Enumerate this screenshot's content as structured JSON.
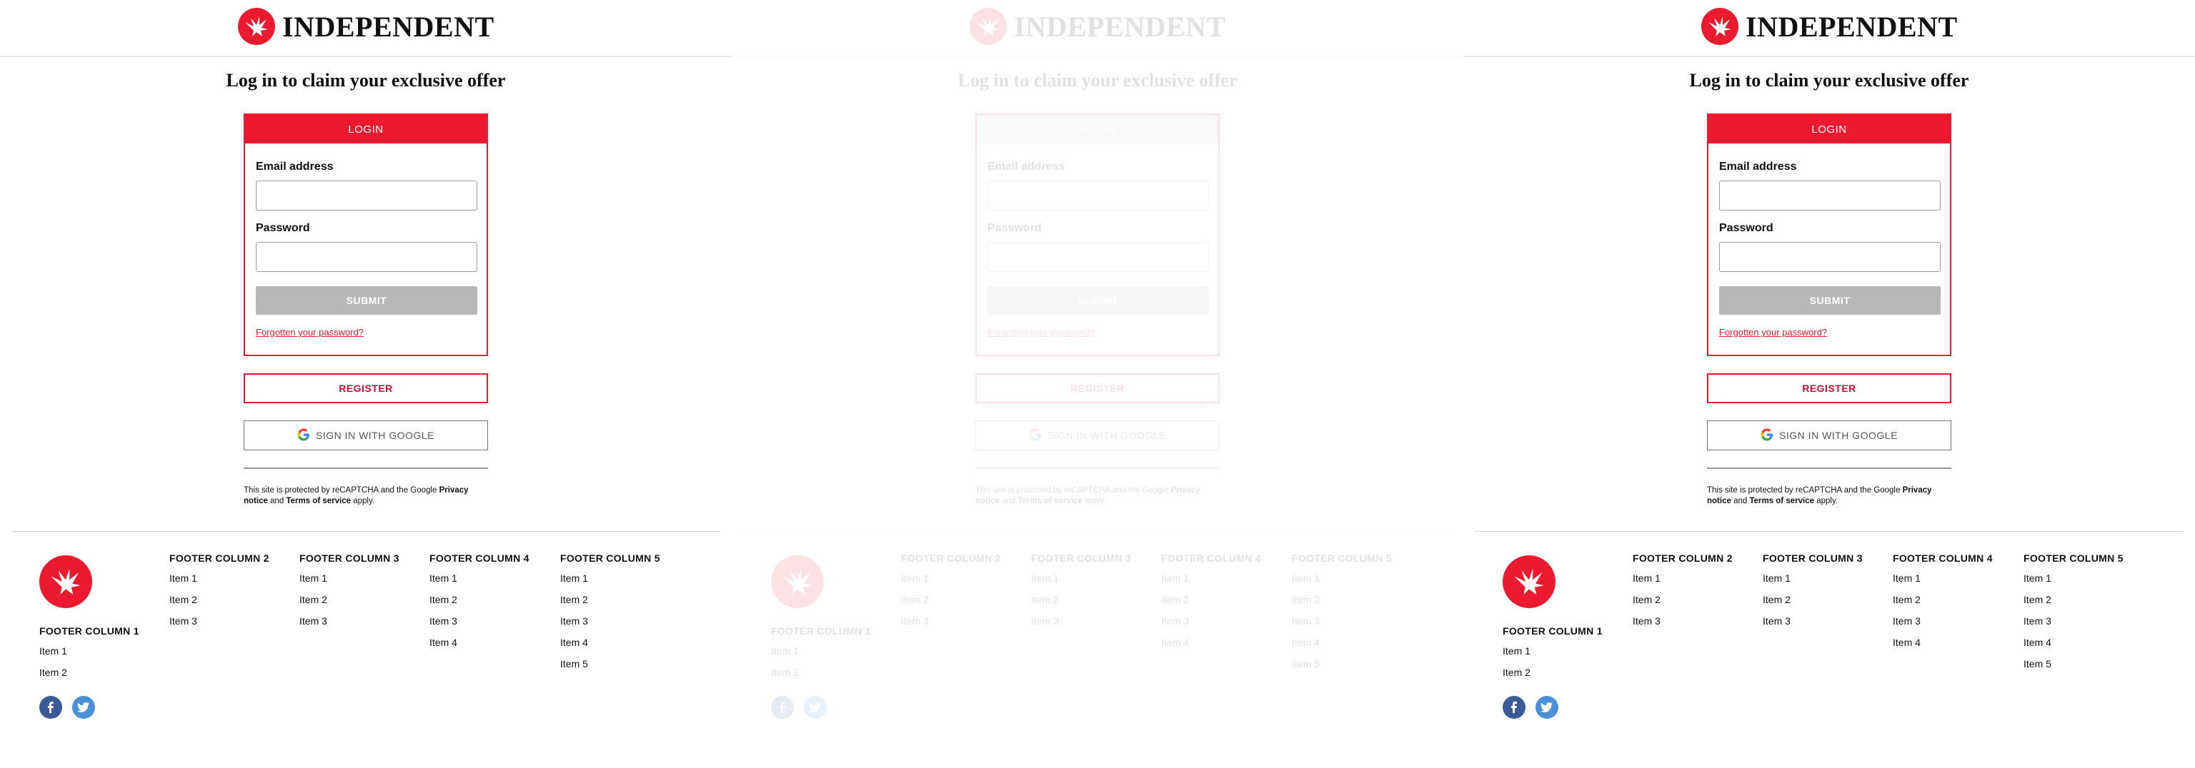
{
  "brand": {
    "name": "INDEPENDENT",
    "icon": "eagle-logo-icon",
    "accent": "#ec1a2e"
  },
  "page": {
    "title": "Log in to claim your exclusive offer"
  },
  "login": {
    "tab_label": "LOGIN",
    "email_label": "Email address",
    "email_value": "",
    "password_label": "Password",
    "password_value": "",
    "toggle_icon": "eye-off-icon",
    "submit_label": "SUBMIT",
    "forgot_label": "Forgotten your password?"
  },
  "register_label": "REGISTER",
  "google_label": "SIGN IN WITH GOOGLE",
  "recaptcha": {
    "prefix": "This site is protected by reCAPTCHA and the Google ",
    "privacy": "Privacy notice",
    "and": " and ",
    "terms": "Terms of service",
    "suffix": " apply."
  },
  "footer": {
    "columns": [
      {
        "title": "FOOTER COLUMN 1",
        "items": [
          "Item 1",
          "Item 2"
        ]
      },
      {
        "title": "FOOTER COLUMN 2",
        "items": [
          "Item 1",
          "Item 2",
          "Item 3"
        ]
      },
      {
        "title": "FOOTER COLUMN 3",
        "items": [
          "Item 1",
          "Item 2",
          "Item 3"
        ]
      },
      {
        "title": "FOOTER COLUMN 4",
        "items": [
          "Item 1",
          "Item 2",
          "Item 3",
          "Item 4"
        ]
      },
      {
        "title": "FOOTER COLUMN 5",
        "items": [
          "Item 1",
          "Item 2",
          "Item 3",
          "Item 4",
          "Item 5"
        ]
      }
    ],
    "social": [
      "facebook-icon",
      "twitter-icon"
    ]
  }
}
